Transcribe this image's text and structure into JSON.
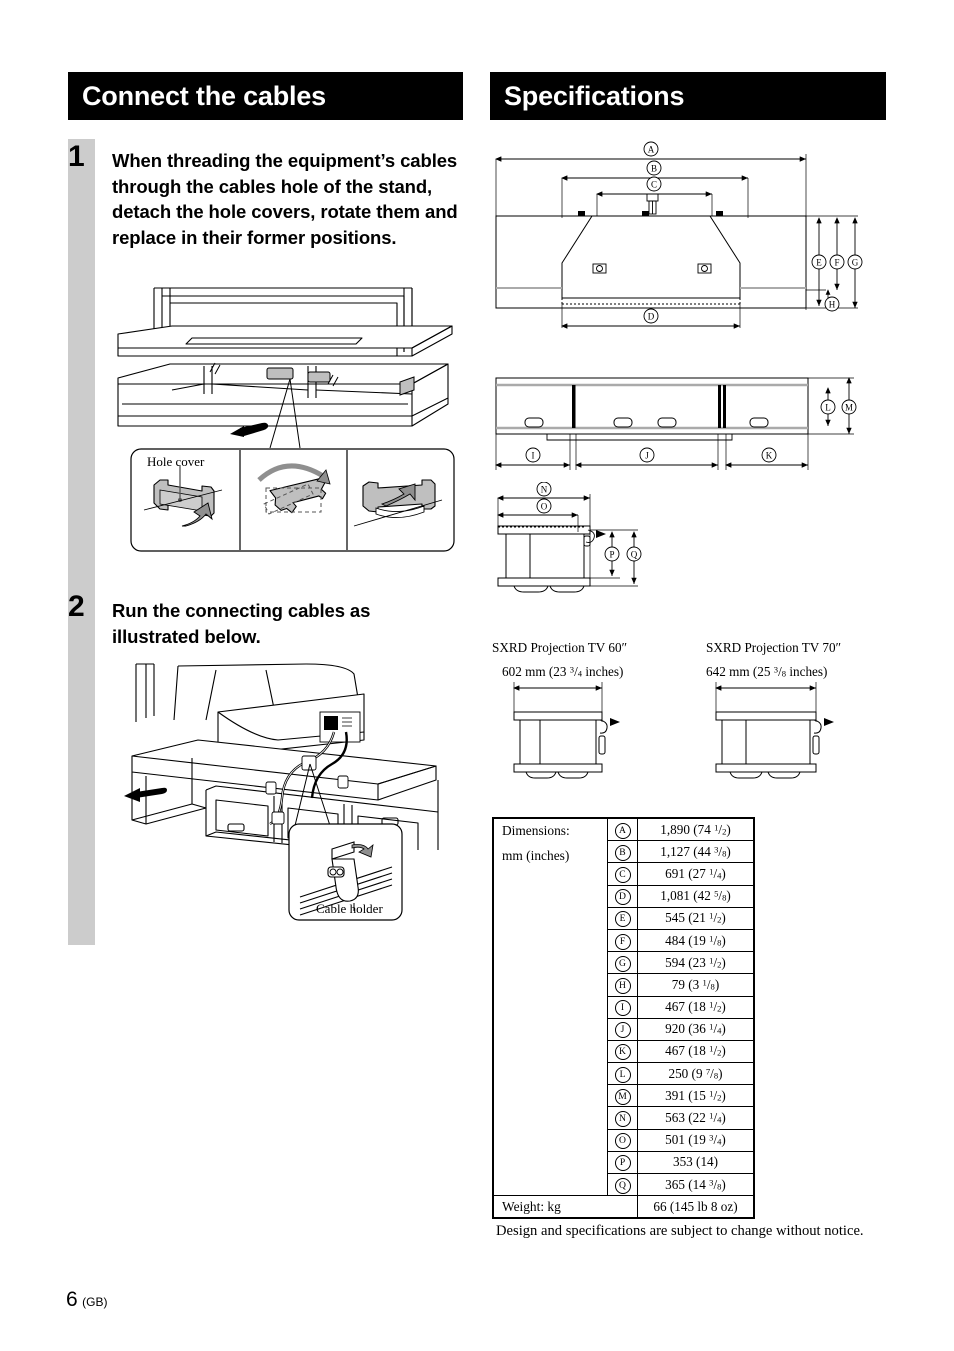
{
  "page": {
    "number": "6",
    "region": "(GB)"
  },
  "sections": {
    "left": {
      "banner_title": "Connect the cables",
      "steps": [
        {
          "number": "1",
          "text": "When threading the equipment’s cables through the cables hole of the stand, detach the hole covers, rotate them and replace in their former positions.",
          "callout_label": "Hole cover"
        },
        {
          "number": "2",
          "text": "Run the connecting cables as illustrated below.",
          "callout_label": "Cable holder"
        }
      ]
    },
    "right": {
      "banner_title": "Specifications",
      "diagram_markers": {
        "front_top": [
          "A",
          "B",
          "C"
        ],
        "front_bottom": [
          "D"
        ],
        "front_right": [
          "E",
          "F",
          "G",
          "H"
        ],
        "plan_bottom": [
          "I",
          "J",
          "K"
        ],
        "plan_right": [
          "L",
          "M"
        ],
        "side_top": [
          "N",
          "O"
        ],
        "side_right": [
          "P",
          "Q"
        ]
      },
      "tv_models": [
        {
          "name": "SXRD Projection TV 60″",
          "dimension_mm": "602 mm",
          "dimension_in": "(23 3/4 inches)",
          "dim_whole": "23",
          "dim_num": "3",
          "dim_den": "4"
        },
        {
          "name": "SXRD Projection TV 70″",
          "dimension_mm": "642 mm",
          "dimension_in": "(25 3/8 inches)",
          "dim_whole": "25",
          "dim_num": "3",
          "dim_den": "8"
        }
      ],
      "spec_table": {
        "row_label_1": "Dimensions:",
        "row_label_2": "mm (inches)",
        "weight_label": "Weight: kg",
        "weight_value": "66 (145 lb 8 oz)",
        "rows": [
          {
            "key": "A",
            "mm": "1,890",
            "inch_whole": "74",
            "num": "1",
            "den": "2"
          },
          {
            "key": "B",
            "mm": "1,127",
            "inch_whole": "44",
            "num": "3",
            "den": "8"
          },
          {
            "key": "C",
            "mm": "691",
            "inch_whole": "27",
            "num": "1",
            "den": "4"
          },
          {
            "key": "D",
            "mm": "1,081",
            "inch_whole": "42",
            "num": "5",
            "den": "8"
          },
          {
            "key": "E",
            "mm": "545",
            "inch_whole": "21",
            "num": "1",
            "den": "2"
          },
          {
            "key": "F",
            "mm": "484",
            "inch_whole": "19",
            "num": "1",
            "den": "8"
          },
          {
            "key": "G",
            "mm": "594",
            "inch_whole": "23",
            "num": "1",
            "den": "2"
          },
          {
            "key": "H",
            "mm": "79",
            "inch_whole": "3",
            "num": "1",
            "den": "8"
          },
          {
            "key": "I",
            "mm": "467",
            "inch_whole": "18",
            "num": "1",
            "den": "2"
          },
          {
            "key": "J",
            "mm": "920",
            "inch_whole": "36",
            "num": "1",
            "den": "4"
          },
          {
            "key": "K",
            "mm": "467",
            "inch_whole": "18",
            "num": "1",
            "den": "2"
          },
          {
            "key": "L",
            "mm": "250",
            "inch_whole": "9",
            "num": "7",
            "den": "8"
          },
          {
            "key": "M",
            "mm": "391",
            "inch_whole": "15",
            "num": "1",
            "den": "2"
          },
          {
            "key": "N",
            "mm": "563",
            "inch_whole": "22",
            "num": "1",
            "den": "4"
          },
          {
            "key": "O",
            "mm": "501",
            "inch_whole": "19",
            "num": "3",
            "den": "4"
          },
          {
            "key": "P",
            "mm": "353",
            "inch_whole": "14",
            "num": "",
            "den": ""
          },
          {
            "key": "Q",
            "mm": "365",
            "inch_whole": "14",
            "num": "3",
            "den": "8"
          }
        ]
      },
      "notice": "Design and specifications are subject to change without notice."
    }
  },
  "colors": {
    "banner_bg": "#000000",
    "banner_fg": "#ffffff",
    "gray_bar": "#cccccc",
    "art_fill": "#bfbfbf",
    "line": "#000000"
  }
}
